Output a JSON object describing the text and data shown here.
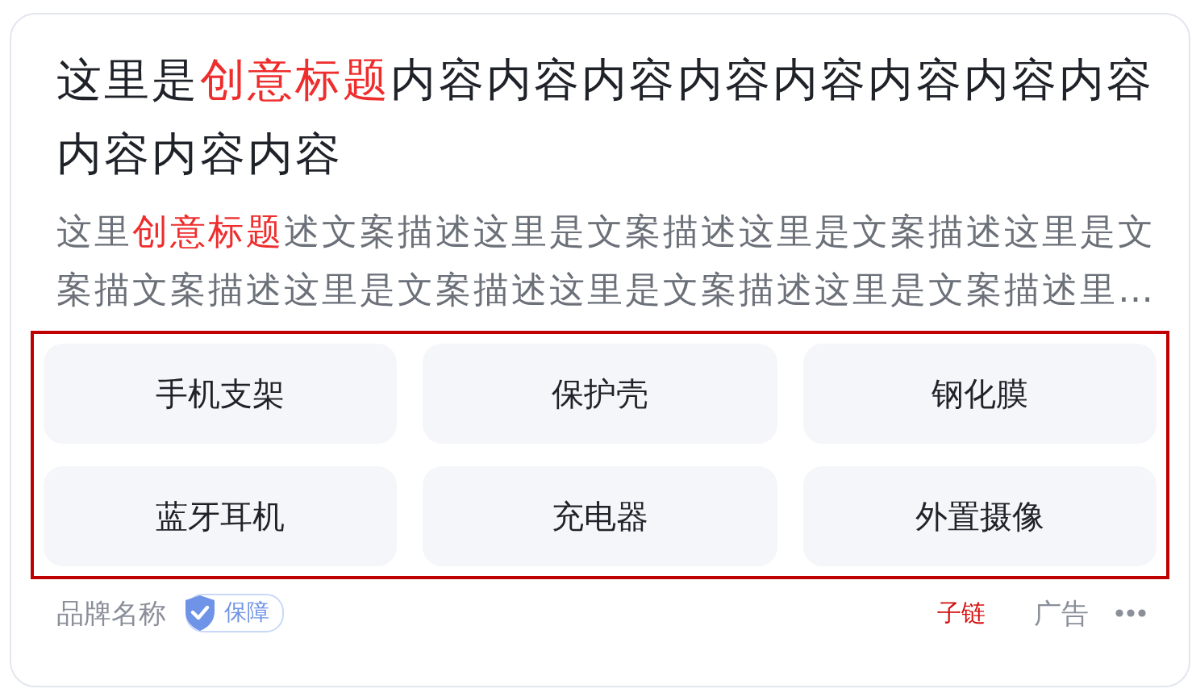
{
  "title": [
    {
      "text": "这里是",
      "highlight": false
    },
    {
      "text": "创意标题",
      "highlight": true
    },
    {
      "text": "内容内容内容内容内容内容内容内容内容内容内容",
      "highlight": false
    }
  ],
  "description": [
    {
      "text": "这里",
      "highlight": false
    },
    {
      "text": "创意标题",
      "highlight": true
    },
    {
      "text": "述文案描述这里是文案描述这里是文案描述这里是文案描文案描述这里是文案描述这里是文案描述这里是文案描述里…",
      "highlight": false
    }
  ],
  "chips": [
    "手机支架",
    "保护壳",
    "钢化膜",
    "蓝牙耳机",
    "充电器",
    "外置摄像"
  ],
  "footer": {
    "brand": "品牌名称",
    "badge": "保障",
    "sublink": "子链",
    "ad_label": "广告"
  }
}
